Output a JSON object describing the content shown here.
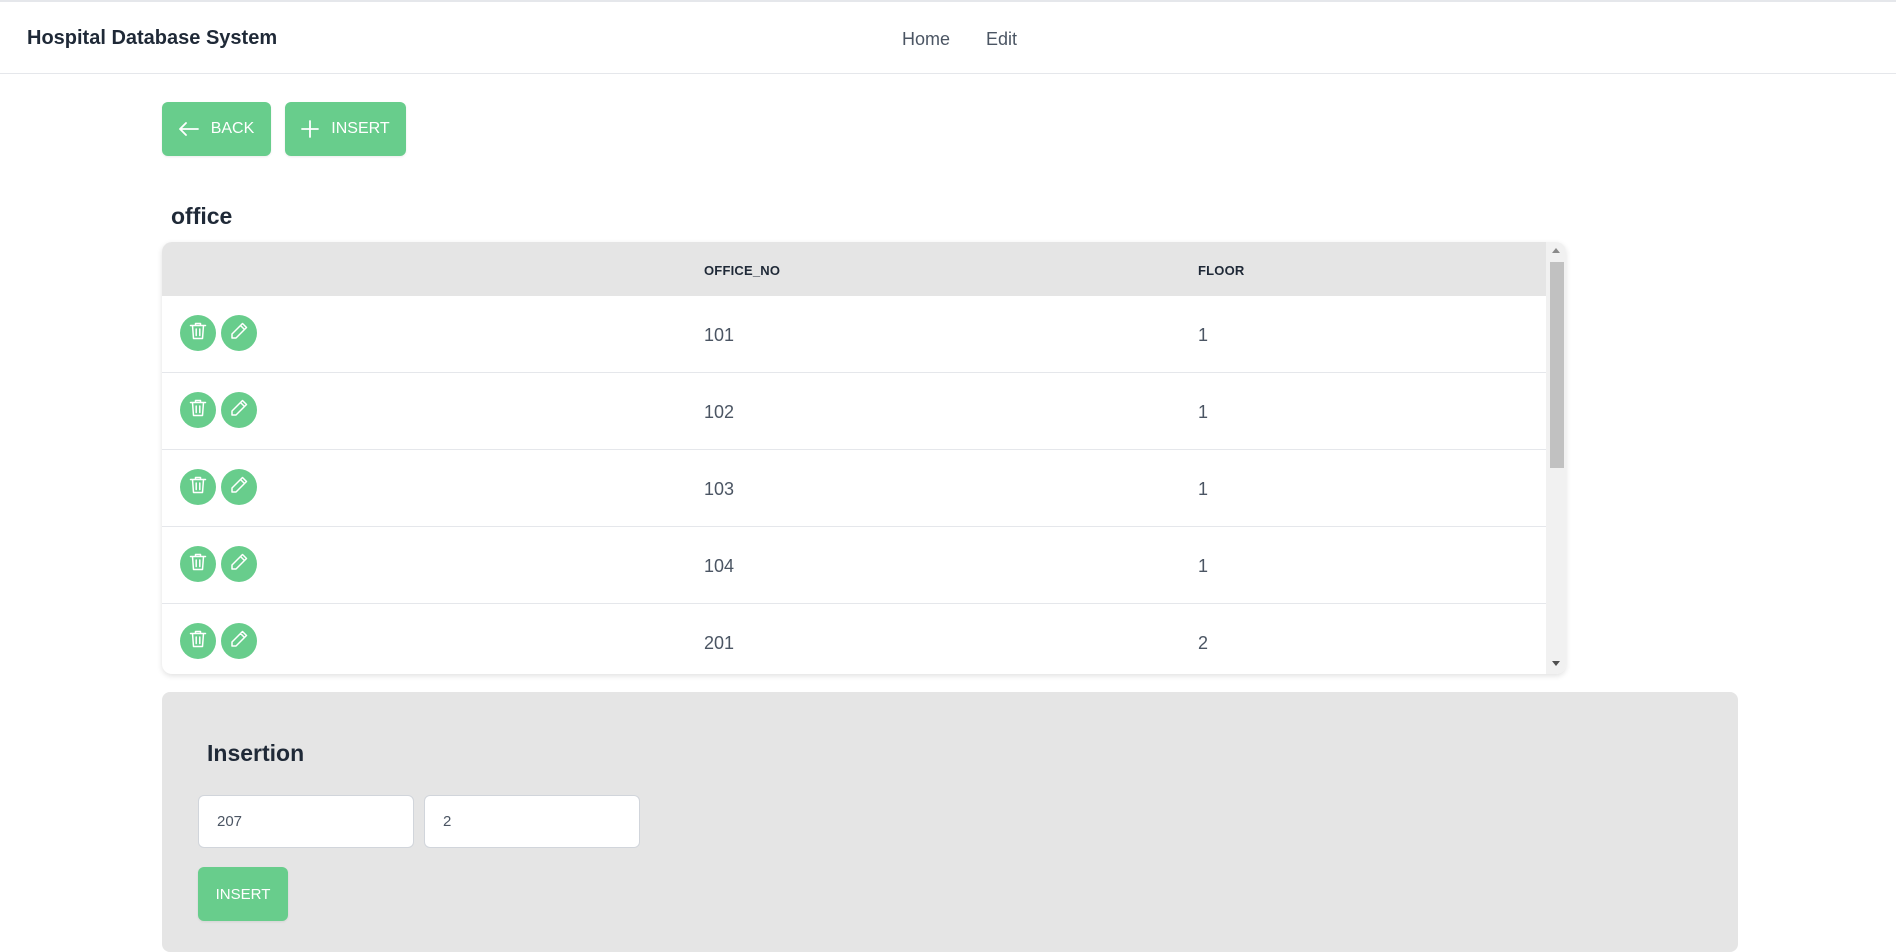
{
  "header": {
    "brand": "Hospital Database System",
    "nav": [
      "Home",
      "Edit"
    ]
  },
  "toolbar": {
    "back_label": "BACK",
    "insert_label": "INSERT"
  },
  "table": {
    "title": "office",
    "columns": [
      "OFFICE_NO",
      "FLOOR"
    ],
    "rows": [
      {
        "office_no": "101",
        "floor": "1"
      },
      {
        "office_no": "102",
        "floor": "1"
      },
      {
        "office_no": "103",
        "floor": "1"
      },
      {
        "office_no": "104",
        "floor": "1"
      },
      {
        "office_no": "201",
        "floor": "2"
      }
    ]
  },
  "insertion": {
    "title": "Insertion",
    "office_no_value": "207",
    "floor_value": "2",
    "submit_label": "INSERT"
  },
  "colors": {
    "accent": "#68cd8c",
    "header_bg": "#e5e5e5"
  },
  "icons": {
    "back": "arrow-left-icon",
    "insert": "plus-icon",
    "delete": "trash-icon",
    "edit": "pencil-icon"
  }
}
